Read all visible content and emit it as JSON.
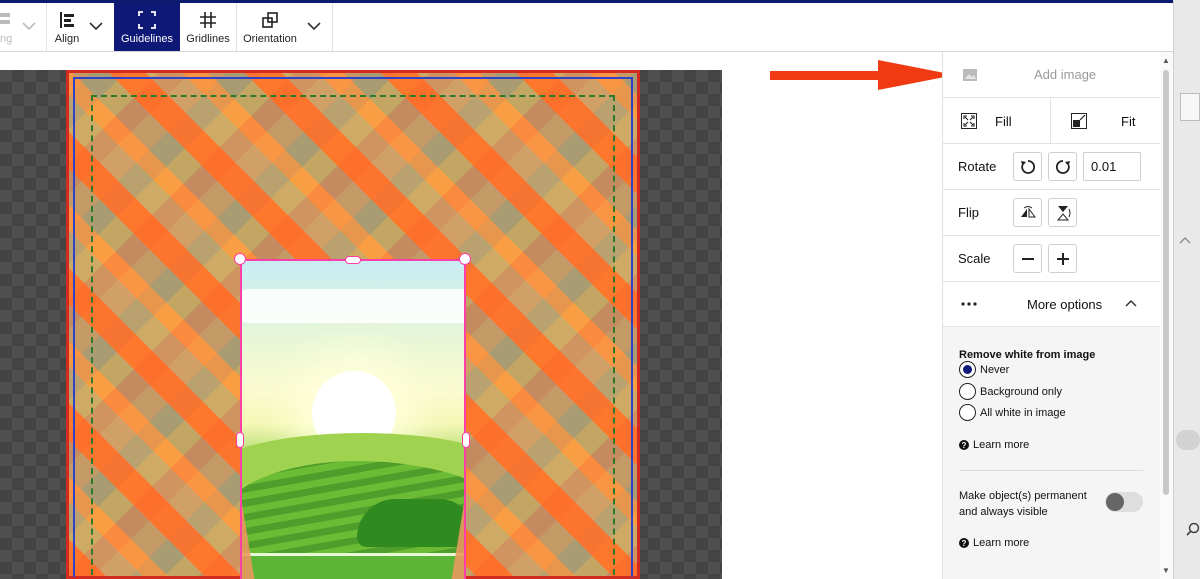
{
  "toolbar": {
    "partial_label": "ng",
    "align_label": "Align",
    "guidelines_label": "Guidelines",
    "gridlines_label": "Gridlines",
    "orientation_label": "Orientation"
  },
  "panel": {
    "add_image_label": "Add image",
    "fill_label": "Fill",
    "fit_label": "Fit",
    "rotate_label": "Rotate",
    "rotate_value": "0.01",
    "flip_label": "Flip",
    "scale_label": "Scale",
    "more_options_label": "More options",
    "remove_white": {
      "title": "Remove white from image",
      "options": [
        "Never",
        "Background only",
        "All white in image"
      ],
      "selected": "Never",
      "learn_more": "Learn more"
    },
    "permanent": {
      "label": "Make object(s) permanent and always visible",
      "enabled": false,
      "learn_more": "Learn more"
    }
  },
  "colors": {
    "accent": "#0d1877",
    "selection": "#ff3fa8",
    "bleed": "#d32b1f",
    "arrow": "#f03a12"
  }
}
